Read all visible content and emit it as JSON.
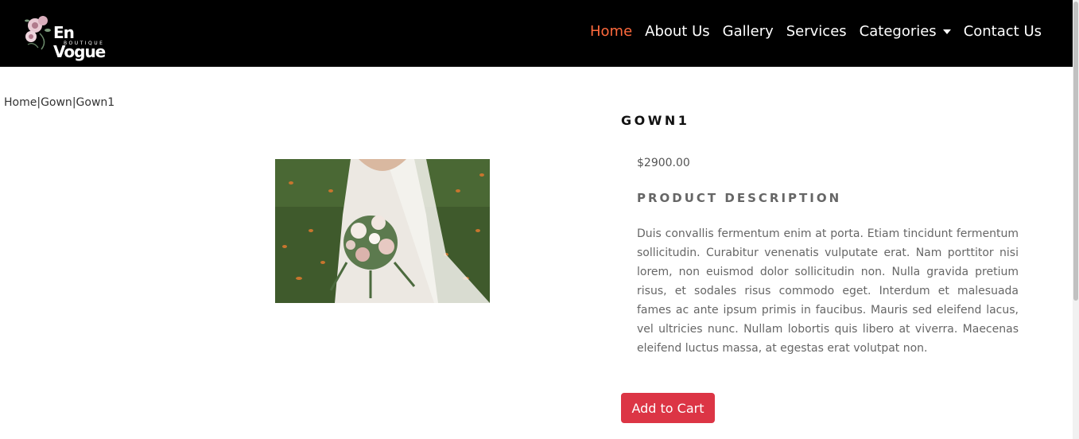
{
  "header": {
    "brand": "En Vogue",
    "brand_sub": "BOUTIQUE",
    "nav": [
      {
        "label": "Home",
        "active": true
      },
      {
        "label": "About Us"
      },
      {
        "label": "Gallery"
      },
      {
        "label": "Services"
      },
      {
        "label": "Categories",
        "dropdown": true
      },
      {
        "label": "Contact Us"
      }
    ]
  },
  "breadcrumb": {
    "items": [
      "Home",
      "Gown",
      "Gown1"
    ],
    "separator": "|"
  },
  "product": {
    "title": "GOWN1",
    "price": "$2900.00",
    "description_heading": "PRODUCT DESCRIPTION",
    "description": "Duis convallis fermentum enim at porta. Etiam tincidunt fermentum sollicitudin. Curabitur venenatis vulputate erat. Nam porttitor nisi lorem, non euismod dolor sollicitudin non. Nulla gravida pretium risus, et sodales risus commodo eget. Interdum et malesuada fames ac ante ipsum primis in faucibus. Mauris sed eleifend lacus, vel ultricies nunc. Nullam lobortis quis libero at viverra. Maecenas eleifend luctus massa, at egestas erat volutpat non.",
    "add_to_cart_label": "Add to Cart"
  },
  "colors": {
    "nav_bg": "#000000",
    "nav_active": "#ff6a3d",
    "button": "#dc3545"
  }
}
